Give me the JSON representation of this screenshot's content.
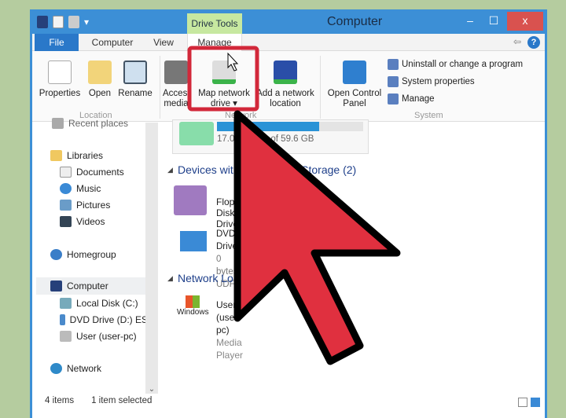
{
  "window": {
    "title": "Computer",
    "context_tab": "Drive Tools",
    "close": "x",
    "minimize": "‒",
    "maximize": "☐"
  },
  "tabs": [
    "File",
    "Computer",
    "View",
    "Manage"
  ],
  "ribbon": {
    "location": {
      "label": "Location",
      "buttons": [
        "Properties",
        "Open",
        "Rename"
      ]
    },
    "network": {
      "label": "Network",
      "buttons": [
        "Access media",
        "Map network drive ▾",
        "Add a network location"
      ]
    },
    "system": {
      "label": "System",
      "open_control_panel": "Open Control Panel",
      "items": [
        "Uninstall or change a program",
        "System properties",
        "Manage"
      ]
    }
  },
  "nav": {
    "items": [
      "Recent places",
      "Libraries",
      "Documents",
      "Music",
      "Pictures",
      "Videos",
      "Homegroup",
      "Computer",
      "Local Disk (C:)",
      "DVD Drive (D:) ES",
      "User (user-pc)",
      "Network"
    ],
    "selected": "Computer"
  },
  "content": {
    "disk_free": "17.0 GB free of 59.6 GB",
    "disk_used_fraction": 0.7,
    "devices_header": "Devices with Removable Storage (2)",
    "devices": [
      {
        "name": "Floppy Disk Drive"
      },
      {
        "name": "DVD Drive",
        "line2": "0 bytes",
        "line3": "UDF"
      }
    ],
    "network_header": "Network Location",
    "network_items": [
      {
        "name": "User (user-pc)",
        "sub": "Media Player",
        "logo": "Windows Media Player"
      }
    ]
  },
  "status": {
    "items": "4 items",
    "selected": "1 item selected"
  },
  "annotation": {
    "arrow_color": "#e0303f",
    "highlight_color": "#d2283a"
  }
}
